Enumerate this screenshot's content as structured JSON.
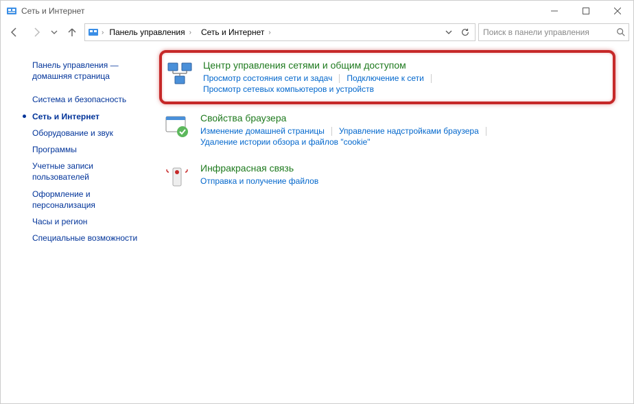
{
  "window": {
    "title": "Сеть и Интернет"
  },
  "breadcrumb": {
    "root": "Панель управления",
    "current": "Сеть и Интернет"
  },
  "search": {
    "placeholder": "Поиск в панели управления"
  },
  "sidebar": {
    "home": "Панель управления — домашняя страница",
    "items": [
      {
        "label": "Система и безопасность"
      },
      {
        "label": "Сеть и Интернет",
        "current": true
      },
      {
        "label": "Оборудование и звук"
      },
      {
        "label": "Программы"
      },
      {
        "label": "Учетные записи пользователей"
      },
      {
        "label": "Оформление и персонализация"
      },
      {
        "label": "Часы и регион"
      },
      {
        "label": "Специальные возможности"
      }
    ]
  },
  "categories": [
    {
      "title": "Центр управления сетями и общим доступом",
      "links": [
        "Просмотр состояния сети и задач",
        "Подключение к сети",
        "Просмотр сетевых компьютеров и устройств"
      ],
      "highlighted": true,
      "icon": "network"
    },
    {
      "title": "Свойства браузера",
      "links": [
        "Изменение домашней страницы",
        "Управление надстройками браузера",
        "Удаление истории обзора и файлов \"cookie\""
      ],
      "icon": "browser"
    },
    {
      "title": "Инфракрасная связь",
      "links": [
        "Отправка и получение файлов"
      ],
      "icon": "infrared"
    }
  ]
}
